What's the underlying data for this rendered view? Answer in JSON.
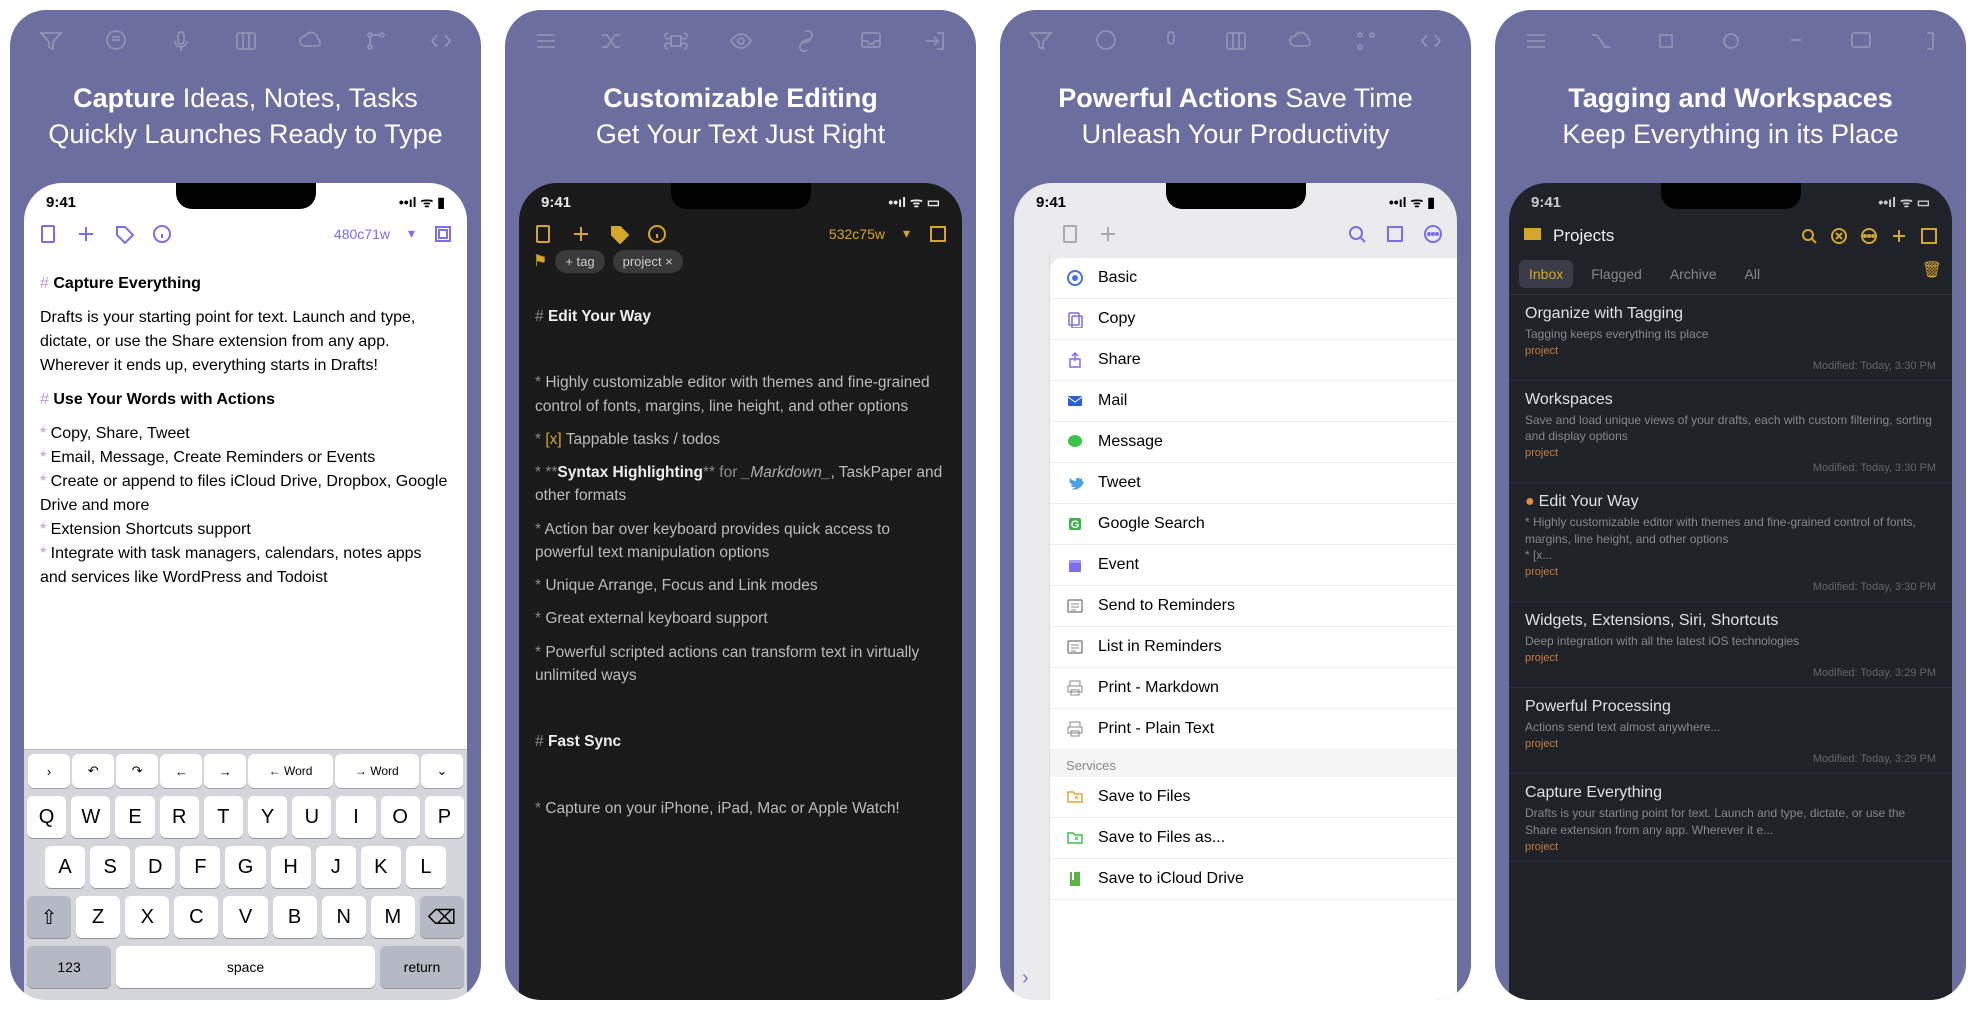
{
  "status": {
    "time": "9:41",
    "signal": "••ıl",
    "wifi": "⬙",
    "battery": "■"
  },
  "cards": [
    {
      "headline_bold": "Capture",
      "headline_rest": " Ideas, Notes, Tasks Quickly Launches Ready to Type",
      "wordcount": "480c71w",
      "h1": "Capture Everything",
      "para": "Drafts is your starting point for text. Launch and type, dictate, or use the Share extension from any app. Wherever it ends up, everything starts in Drafts!",
      "h2": "Use Your Words with Actions",
      "bullets": [
        "Copy, Share, Tweet",
        "Email, Message, Create Reminders or Events",
        "Create or append to files iCloud Drive, Dropbox, Google Drive and more",
        "Extension Shortcuts support",
        "Integrate with task managers, calendars, notes apps and services like WordPress and Todoist"
      ],
      "kbdbar": [
        "›",
        "↶",
        "↷",
        "←",
        "→",
        "← Word",
        "→ Word",
        "⌄"
      ],
      "kb1": [
        "Q",
        "W",
        "E",
        "R",
        "T",
        "Y",
        "U",
        "I",
        "O",
        "P"
      ],
      "kb2": [
        "A",
        "S",
        "D",
        "F",
        "G",
        "H",
        "J",
        "K",
        "L"
      ],
      "kb3": [
        "⇧",
        "Z",
        "X",
        "C",
        "V",
        "B",
        "N",
        "M",
        "⌫"
      ],
      "kb4_123": "123",
      "kb4_space": "space",
      "kb4_return": "return"
    },
    {
      "headline_bold": "Customizable Editing",
      "headline_rest": "\nGet Your Text Just Right",
      "wordcount": "532c75w",
      "tag_add": "+ tag",
      "tag_project": "project",
      "h1": "Edit Your Way",
      "lines": [
        {
          "pre": "* ",
          "text": "Highly customizable editor with themes and fine-grained control of fonts, margins, line height, and other options"
        },
        {
          "pre": "* ",
          "check": "[x]",
          "text": " Tappable tasks / todos"
        },
        {
          "pre": "* **",
          "bold": "Syntax Highlighting",
          "post": "** for ",
          "italic": "_Markdown_",
          "text2": ", TaskPaper and other formats"
        },
        {
          "pre": "* ",
          "text": "Action bar over keyboard provides quick access to powerful text manipulation options"
        },
        {
          "pre": "* ",
          "text": "Unique Arrange, Focus and Link modes"
        },
        {
          "pre": "* ",
          "text": "Great external keyboard support"
        },
        {
          "pre": "* ",
          "text": "Powerful scripted actions can transform text in virtually unlimited ways"
        }
      ],
      "h2": "Fast Sync",
      "last": "Capture on your iPhone, iPad, Mac or Apple Watch!"
    },
    {
      "headline_bold": "Powerful Actions",
      "headline_rest": " Save Time Unleash Your Productivity",
      "actions": [
        {
          "icon": "target",
          "color": "#4a6ee8",
          "label": "Basic"
        },
        {
          "icon": "copy",
          "color": "#7b6ee8",
          "label": "Copy"
        },
        {
          "icon": "share",
          "color": "#7b6ee8",
          "label": "Share"
        },
        {
          "icon": "mail",
          "color": "#2b5fd4",
          "label": "Mail"
        },
        {
          "icon": "msg",
          "color": "#3cc24a",
          "label": "Message"
        },
        {
          "icon": "tweet",
          "color": "#4aa0e8",
          "label": "Tweet"
        },
        {
          "icon": "google",
          "color": "#3cb24a",
          "label": "Google Search"
        },
        {
          "icon": "cal",
          "color": "#7b6ee8",
          "label": "Event"
        },
        {
          "icon": "list",
          "color": "#888",
          "label": "Send to Reminders"
        },
        {
          "icon": "list",
          "color": "#888",
          "label": "List in Reminders"
        },
        {
          "icon": "print",
          "color": "#888",
          "label": "Print - Markdown"
        },
        {
          "icon": "print",
          "color": "#888",
          "label": "Print - Plain Text"
        }
      ],
      "section": "Services",
      "services": [
        {
          "icon": "folder",
          "color": "#e8a23c",
          "label": "Save to Files"
        },
        {
          "icon": "folder",
          "color": "#3cc24a",
          "label": "Save to Files as..."
        },
        {
          "icon": "book",
          "color": "#5cb24a",
          "label": "Save to iCloud Drive"
        }
      ]
    },
    {
      "headline_bold": "Tagging and Workspaces",
      "headline_rest": "\nKeep Everything in its Place",
      "projects_title": "Projects",
      "tabs": [
        "Inbox",
        "Flagged",
        "Archive",
        "All"
      ],
      "drafts": [
        {
          "title": "Organize with Tagging",
          "desc": "Tagging keeps everything its place",
          "tag": "project",
          "meta": "Modified: Today, 3:30 PM"
        },
        {
          "title": "Workspaces",
          "desc": "Save and load unique views of your drafts, each with custom filtering, sorting and display options",
          "tag": "project",
          "meta": "Modified: Today, 3:30 PM"
        },
        {
          "dot": true,
          "title": "Edit Your Way",
          "desc": "* Highly customizable editor with themes and fine-grained control of fonts, margins, line height, and other options\n* [x...",
          "tag": "project",
          "meta": "Modified: Today, 3:30 PM"
        },
        {
          "title": "Widgets, Extensions, Siri, Shortcuts",
          "desc": "Deep integration with all the latest iOS technologies",
          "tag": "project",
          "meta": "Modified: Today, 3:29 PM"
        },
        {
          "title": "Powerful Processing",
          "desc": "Actions send text almost anywhere...",
          "tag": "project",
          "meta": "Modified: Today, 3:29 PM"
        },
        {
          "title": "Capture Everything",
          "desc": "Drafts is your starting point for text. Launch and type, dictate, or use the Share extension from any app. Wherever it e...",
          "tag": "project",
          "meta": ""
        }
      ]
    }
  ]
}
